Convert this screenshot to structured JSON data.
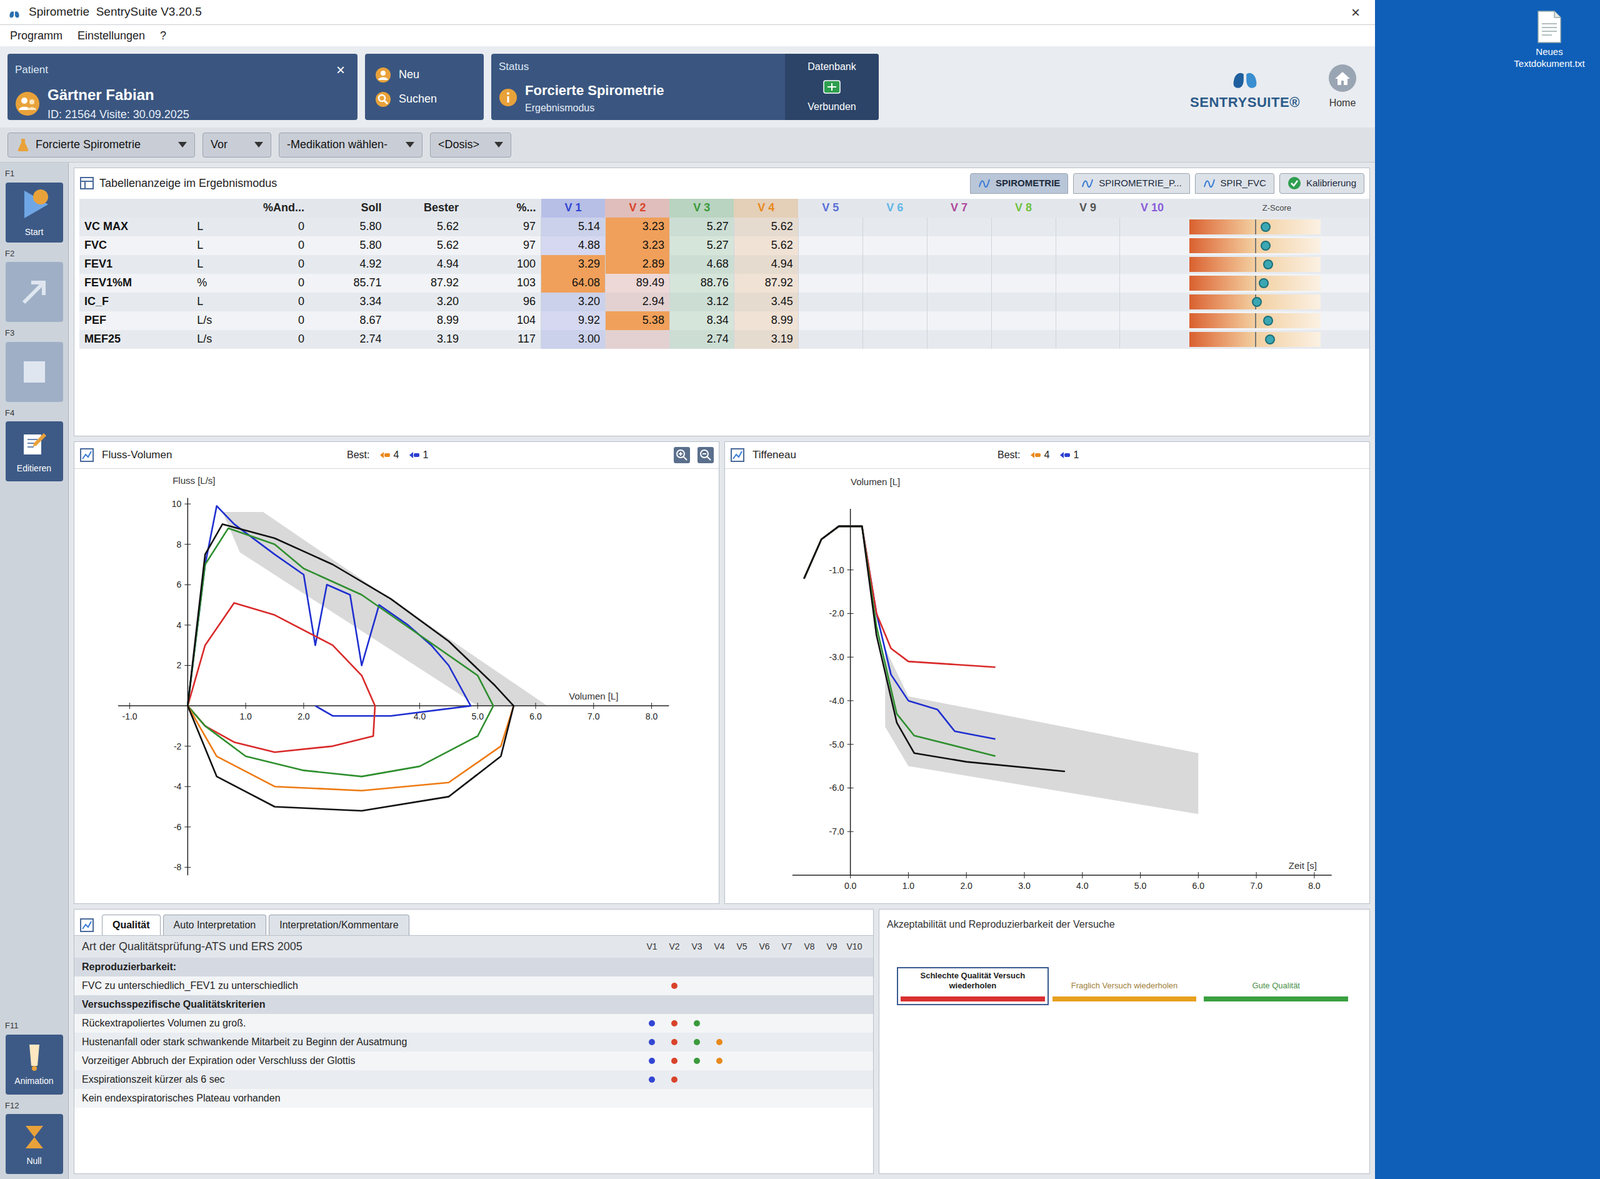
{
  "window": {
    "title": "Spirometrie  SentrySuite V3.20.5",
    "close": "×"
  },
  "menu": [
    "Programm",
    "Einstellungen",
    "?"
  ],
  "patient": {
    "label": "Patient",
    "name": "Gärtner Fabian",
    "id": "ID: 21564 Visite: 30.09.2025",
    "close": "×"
  },
  "patient_buttons": [
    "Neu",
    "Suchen"
  ],
  "status": {
    "label": "Status",
    "title": "Forcierte Spirometrie",
    "mode": "Ergebnismodus",
    "db_label": "Datenbank",
    "db_state": "Verbunden"
  },
  "brand": {
    "logo": "SENTRYSUITE®",
    "home": "Home"
  },
  "toolbar": [
    "Forcierte Spirometrie",
    "Vor",
    "-Medikation wählen-",
    "<Dosis>"
  ],
  "sidebar": [
    {
      "key": "F1",
      "label": "Start",
      "disabled": false
    },
    {
      "key": "F2",
      "disabled": true
    },
    {
      "key": "F3",
      "disabled": true
    },
    {
      "key": "F4",
      "label": "Editieren",
      "disabled": false
    }
  ],
  "sidebar_bottom": [
    {
      "key": "F11",
      "label": "Animation"
    },
    {
      "key": "F12",
      "label": "Null"
    }
  ],
  "tabs": [
    {
      "label": "SPIROMETRIE",
      "selected": true
    },
    {
      "label": "SPIROMETRIE_P...",
      "selected": false
    },
    {
      "label": "SPIR_FVC",
      "selected": false
    }
  ],
  "calibration": "Kalibrierung",
  "table": {
    "title": "Tabellenanzeige im Ergebnismodus",
    "columns": [
      "%And...",
      "Soll",
      "Bester",
      "%..."
    ],
    "zscore_label": "Z-Score",
    "trials": [
      {
        "label": "V 1",
        "color": "#3346d3"
      },
      {
        "label": "V 2",
        "color": "#d9432b"
      },
      {
        "label": "V 3",
        "color": "#3b9a3b"
      },
      {
        "label": "V 4",
        "color": "#e8891c"
      },
      {
        "label": "V 5",
        "color": "#5a6fd8"
      },
      {
        "label": "V 6",
        "color": "#62b6e6"
      },
      {
        "label": "V 7",
        "color": "#b0479c"
      },
      {
        "label": "V 8",
        "color": "#72c23f"
      },
      {
        "label": "V 9",
        "color": "#555555"
      },
      {
        "label": "V 10",
        "color": "#8a5cd8"
      }
    ],
    "rows": [
      {
        "param": "VC MAX",
        "unit": "L",
        "change": "0",
        "pred": "5.80",
        "best": "5.62",
        "pct": "97",
        "z": 0.5,
        "values": [
          {
            "v": "5.14",
            "flag": false
          },
          {
            "v": "3.23",
            "flag": true
          },
          {
            "v": "5.27",
            "flag": false
          },
          {
            "v": "5.62",
            "flag": false
          }
        ]
      },
      {
        "param": "FVC",
        "unit": "L",
        "change": "0",
        "pred": "5.80",
        "best": "5.62",
        "pct": "97",
        "z": 0.5,
        "values": [
          {
            "v": "4.88",
            "flag": false
          },
          {
            "v": "3.23",
            "flag": true
          },
          {
            "v": "5.27",
            "flag": false
          },
          {
            "v": "5.62",
            "flag": false
          }
        ]
      },
      {
        "param": "FEV1",
        "unit": "L",
        "change": "0",
        "pred": "4.92",
        "best": "4.94",
        "pct": "100",
        "z": 0.6,
        "values": [
          {
            "v": "3.29",
            "flag": true
          },
          {
            "v": "2.89",
            "flag": true
          },
          {
            "v": "4.68",
            "flag": false
          },
          {
            "v": "4.94",
            "flag": false
          }
        ]
      },
      {
        "param": "FEV1%M",
        "unit": "%",
        "change": "0",
        "pred": "85.71",
        "best": "87.92",
        "pct": "103",
        "z": 0.4,
        "values": [
          {
            "v": "64.08",
            "flag": true
          },
          {
            "v": "89.49",
            "flag": false
          },
          {
            "v": "88.76",
            "flag": false
          },
          {
            "v": "87.92",
            "flag": false
          }
        ]
      },
      {
        "param": "IC_F",
        "unit": "L",
        "change": "0",
        "pred": "3.34",
        "best": "3.20",
        "pct": "96",
        "z": 0.1,
        "values": [
          {
            "v": "3.20",
            "flag": false
          },
          {
            "v": "2.94",
            "flag": false
          },
          {
            "v": "3.12",
            "flag": false
          },
          {
            "v": "3.45",
            "flag": false
          }
        ]
      },
      {
        "param": "PEF",
        "unit": "L/s",
        "change": "0",
        "pred": "8.67",
        "best": "8.99",
        "pct": "104",
        "z": 0.6,
        "values": [
          {
            "v": "9.92",
            "flag": false
          },
          {
            "v": "5.38",
            "flag": true
          },
          {
            "v": "8.34",
            "flag": false
          },
          {
            "v": "8.99",
            "flag": false
          }
        ]
      },
      {
        "param": "MEF25",
        "unit": "L/s",
        "change": "0",
        "pred": "2.74",
        "best": "3.19",
        "pct": "117",
        "z": 0.7,
        "values": [
          {
            "v": "3.00",
            "flag": false
          },
          {
            "v": "",
            "flag": false
          },
          {
            "v": "2.74",
            "flag": false
          },
          {
            "v": "3.19",
            "flag": false
          }
        ]
      }
    ]
  },
  "flow_volume": {
    "title": "Fluss-Volumen",
    "best_label": "Best:",
    "best_markers": [
      {
        "label": "4",
        "color": "#e8891c"
      },
      {
        "label": "1",
        "color": "#2a3fd0"
      }
    ],
    "y_label": "Fluss [L/s]",
    "x_label": "Volumen [L]",
    "x_ticks": [
      "-1.0",
      "1.0",
      "2.0",
      "4.0",
      "5.0",
      "6.0",
      "7.0",
      "8.0"
    ],
    "y_ticks": [
      "10",
      "8",
      "6",
      "4",
      "2",
      "-2",
      "-4",
      "-6",
      "-8"
    ],
    "predicted_band": [
      [
        0.6,
        9.6
      ],
      [
        1.3,
        9.6
      ],
      [
        6.2,
        0
      ],
      [
        5.0,
        0
      ],
      [
        0.9,
        7.6
      ]
    ],
    "series": [
      {
        "color": "#1f2fd0",
        "points": [
          [
            0,
            0
          ],
          [
            0.3,
            7
          ],
          [
            0.5,
            9.9
          ],
          [
            0.8,
            9
          ],
          [
            1.5,
            7.5
          ],
          [
            2.0,
            6.5
          ],
          [
            2.2,
            3
          ],
          [
            2.4,
            6
          ],
          [
            2.8,
            5.5
          ],
          [
            3.0,
            2
          ],
          [
            3.3,
            5
          ],
          [
            3.8,
            4
          ],
          [
            4.2,
            3
          ],
          [
            4.5,
            2
          ],
          [
            4.88,
            0
          ],
          [
            3.5,
            -0.5
          ],
          [
            2.5,
            -0.5
          ],
          [
            2.2,
            0
          ]
        ]
      },
      {
        "color": "#d92a2a",
        "points": [
          [
            0,
            0
          ],
          [
            0.3,
            3
          ],
          [
            0.8,
            5.1
          ],
          [
            1.5,
            4.5
          ],
          [
            2.5,
            3
          ],
          [
            3.0,
            1.5
          ],
          [
            3.23,
            0
          ],
          [
            3.2,
            -1.5
          ],
          [
            2.5,
            -2
          ],
          [
            1.5,
            -2.3
          ],
          [
            0.8,
            -1.8
          ],
          [
            0.3,
            -1.0
          ],
          [
            0,
            0
          ]
        ]
      },
      {
        "color": "#2e8f2e",
        "points": [
          [
            0,
            0
          ],
          [
            0.3,
            7
          ],
          [
            0.7,
            8.8
          ],
          [
            1.5,
            8
          ],
          [
            2,
            6.8
          ],
          [
            3,
            5.5
          ],
          [
            4,
            3.5
          ],
          [
            5,
            1.5
          ],
          [
            5.27,
            0
          ],
          [
            5.0,
            -1.5
          ],
          [
            4,
            -3
          ],
          [
            3,
            -3.5
          ],
          [
            2,
            -3.2
          ],
          [
            1,
            -2.5
          ],
          [
            0.3,
            -1
          ],
          [
            0,
            0
          ]
        ]
      },
      {
        "color": "#ee7a12",
        "points": [
          [
            5.62,
            0
          ],
          [
            5.4,
            -2
          ],
          [
            4.5,
            -3.8
          ],
          [
            3,
            -4.2
          ],
          [
            1.5,
            -4
          ],
          [
            0.5,
            -2.5
          ],
          [
            0,
            0
          ]
        ]
      },
      {
        "color": "#111111",
        "points": [
          [
            0,
            0
          ],
          [
            0.3,
            7.5
          ],
          [
            0.6,
            9
          ],
          [
            1.5,
            8.3
          ],
          [
            2.5,
            7
          ],
          [
            3.5,
            5.3
          ],
          [
            4.5,
            3.2
          ],
          [
            5.3,
            1
          ],
          [
            5.62,
            0
          ],
          [
            5.4,
            -2.5
          ],
          [
            4.5,
            -4.5
          ],
          [
            3,
            -5.2
          ],
          [
            1.5,
            -5
          ],
          [
            0.5,
            -3.5
          ],
          [
            0,
            0
          ]
        ]
      }
    ]
  },
  "tiffeneau": {
    "title": "Tiffeneau",
    "best_label": "Best:",
    "best_markers": [
      {
        "label": "4",
        "color": "#e8891c"
      },
      {
        "label": "1",
        "color": "#2a3fd0"
      }
    ],
    "y_label": "Volumen [L]",
    "x_label": "Zeit [s]",
    "x_ticks": [
      "0.0",
      "1.0",
      "2.0",
      "3.0",
      "4.0",
      "5.0",
      "6.0",
      "7.0",
      "8.0"
    ],
    "y_ticks": [
      "-1.0",
      "-2.0",
      "-3.0",
      "-4.0",
      "-5.0",
      "-6.0",
      "-7.0"
    ],
    "predicted_band": [
      [
        0.6,
        -2.8
      ],
      [
        1.0,
        -3.9
      ],
      [
        6.0,
        -5.2
      ],
      [
        6.0,
        -6.6
      ],
      [
        1.0,
        -5.5
      ],
      [
        0.6,
        -4.6
      ]
    ],
    "series": [
      {
        "color": "#1f2fd0",
        "points": [
          [
            -0.8,
            -1.2
          ],
          [
            -0.5,
            -0.3
          ],
          [
            -0.2,
            0
          ],
          [
            0.2,
            0
          ],
          [
            0.45,
            -2
          ],
          [
            0.7,
            -3.4
          ],
          [
            1.0,
            -4.0
          ],
          [
            1.5,
            -4.2
          ],
          [
            1.8,
            -4.7
          ],
          [
            2.5,
            -4.88
          ]
        ]
      },
      {
        "color": "#d92a2a",
        "points": [
          [
            -0.8,
            -1.2
          ],
          [
            -0.5,
            -0.3
          ],
          [
            -0.2,
            0
          ],
          [
            0.2,
            0
          ],
          [
            0.45,
            -2
          ],
          [
            0.7,
            -2.8
          ],
          [
            1.0,
            -3.1
          ],
          [
            2.5,
            -3.23
          ]
        ]
      },
      {
        "color": "#2e8f2e",
        "points": [
          [
            -0.8,
            -1.2
          ],
          [
            -0.5,
            -0.3
          ],
          [
            -0.2,
            0
          ],
          [
            0.2,
            0
          ],
          [
            0.45,
            -2.3
          ],
          [
            0.8,
            -4.3
          ],
          [
            1.1,
            -4.8
          ],
          [
            2.5,
            -5.27
          ]
        ]
      },
      {
        "color": "#111111",
        "points": [
          [
            -0.8,
            -1.2
          ],
          [
            -0.5,
            -0.3
          ],
          [
            -0.2,
            0
          ],
          [
            0.2,
            0
          ],
          [
            0.45,
            -2.5
          ],
          [
            0.8,
            -4.5
          ],
          [
            1.1,
            -5.2
          ],
          [
            2.0,
            -5.4
          ],
          [
            3.7,
            -5.62
          ]
        ]
      }
    ]
  },
  "quality": {
    "tabs": [
      {
        "label": "Qualität",
        "selected": true
      },
      {
        "label": "Auto Interpretation",
        "selected": false
      },
      {
        "label": "Interpretation/Kommentare",
        "selected": false
      }
    ],
    "heading": "Art der Qualitätsprüfung-ATS und ERS 2005",
    "columns": [
      "V1",
      "V2",
      "V3",
      "V4",
      "V5",
      "V6",
      "V7",
      "V8",
      "V9",
      "V10"
    ],
    "rows": [
      {
        "text": "Reproduzierbarkeit:",
        "kind": "header"
      },
      {
        "text": "FVC zu unterschiedlich_FEV1 zu unterschiedlich",
        "kind": "item",
        "marks": [
          false,
          true,
          false,
          false
        ]
      },
      {
        "text": "Versuchsspezifische Qualitätskriterien",
        "kind": "header"
      },
      {
        "text": "Rückextrapoliertes Volumen zu groß.",
        "kind": "item",
        "marks": [
          true,
          true,
          true,
          false
        ]
      },
      {
        "text": "Hustenanfall oder stark schwankende Mitarbeit zu Beginn der Ausatmung",
        "kind": "item",
        "marks": [
          true,
          true,
          true,
          true
        ]
      },
      {
        "text": "Vorzeitiger Abbruch der Expiration oder Verschluss der Glottis",
        "kind": "item",
        "marks": [
          true,
          true,
          true,
          true
        ]
      },
      {
        "text": "Exspirationszeit kürzer als 6 sec",
        "kind": "item",
        "marks": [
          true,
          true,
          false,
          false
        ]
      },
      {
        "text": "Kein endexspiratorisches Plateau vorhanden",
        "kind": "item",
        "marks": [
          false,
          false,
          false,
          false
        ]
      }
    ]
  },
  "acceptability": {
    "title": "Akzeptabilität und Reproduzierbarkeit der Versuche",
    "segments": [
      {
        "label": "Schlechte Qualität Versuch wiederholen",
        "color": "#d93030",
        "selected": true
      },
      {
        "label": "Fraglich Versuch wiederholen",
        "color": "#e8a020",
        "selected": false
      },
      {
        "label": "Gute Qualität",
        "color": "#3aa040",
        "selected": false
      }
    ]
  },
  "desktop": {
    "icon": "Neues Textdokument.txt"
  }
}
